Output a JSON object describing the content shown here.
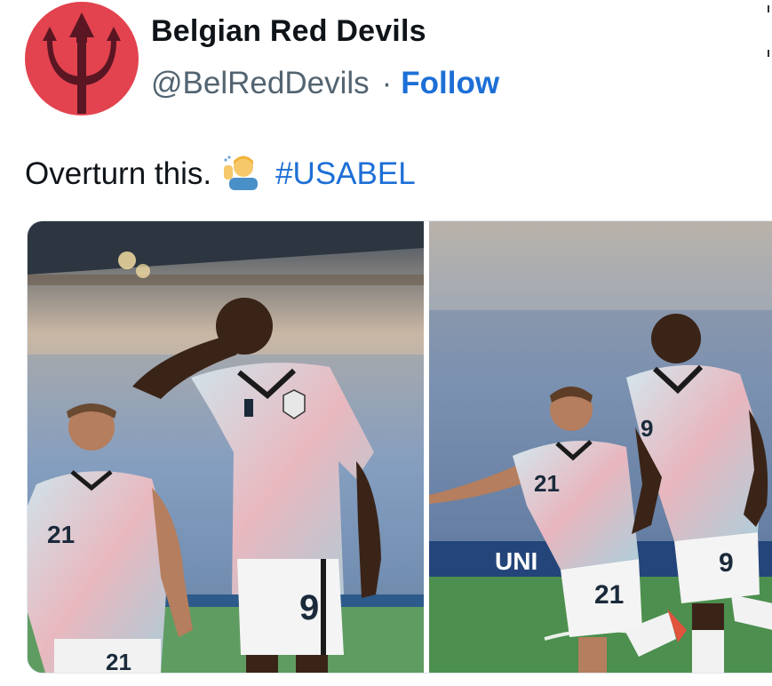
{
  "account": {
    "display_name": "Belgian Red Devils",
    "handle": "@BelRedDevils",
    "separator": "·",
    "follow_label": "Follow",
    "avatar_icon": "trident-icon"
  },
  "tweet": {
    "text": "Overturn this.",
    "emoji": "man-gesturing-call-me emoji",
    "hashtag": "#USABEL"
  },
  "media": {
    "photos": [
      {
        "jersey_numbers": [
          "21",
          "9"
        ]
      },
      {
        "jersey_numbers": [
          "21",
          "9",
          "21",
          "9"
        ],
        "board_text": "UNI"
      }
    ]
  },
  "colors": {
    "avatar_bg": "#e2434f",
    "trident": "#5a1622",
    "link": "#1d6fd6",
    "text": "#0f1419",
    "secondary": "#536471"
  }
}
